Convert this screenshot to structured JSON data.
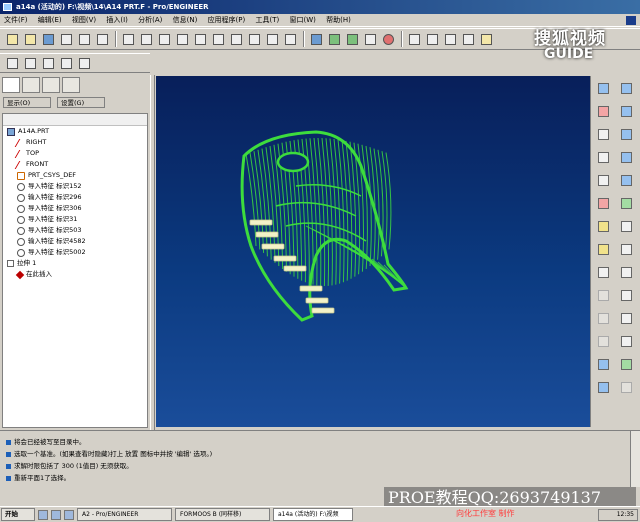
{
  "window": {
    "title": "a14a (活动的) F:\\视频\\14\\A14 PRT.F - Pro/ENGINEER"
  },
  "menubar": {
    "items": [
      "文件(F)",
      "编辑(E)",
      "视图(V)",
      "插入(I)",
      "分析(A)",
      "信息(N)",
      "应用程序(P)",
      "工具(T)",
      "窗口(W)",
      "帮助(H)"
    ]
  },
  "logo": {
    "main": "搜狐视频",
    "sub": "GUIDE"
  },
  "left_panel": {
    "dropdowns": [
      "显示(O)",
      "设置(G)"
    ],
    "tree": [
      {
        "label": "A14A.PRT",
        "icon": "part-icon",
        "indent": 0
      },
      {
        "label": "RIGHT",
        "icon": "datum-plane-icon",
        "indent": 1
      },
      {
        "label": "TOP",
        "icon": "datum-plane-icon",
        "indent": 1
      },
      {
        "label": "FRONT",
        "icon": "datum-plane-icon",
        "indent": 1
      },
      {
        "label": "PRT_CSYS_DEF",
        "icon": "csys-icon",
        "indent": 1
      },
      {
        "label": "导入特征 标识152",
        "icon": "feature-icon",
        "indent": 1
      },
      {
        "label": "输入特征 标识296",
        "icon": "feature-icon",
        "indent": 1
      },
      {
        "label": "导入特征 标识306",
        "icon": "feature-icon",
        "indent": 1
      },
      {
        "label": "导入特征 标识31",
        "icon": "feature-icon",
        "indent": 1
      },
      {
        "label": "导入特征 标识503",
        "icon": "feature-icon",
        "indent": 1
      },
      {
        "label": "输入特征 标识4582",
        "icon": "feature-icon",
        "indent": 1
      },
      {
        "label": "导入特征 标识5002",
        "icon": "feature-icon",
        "indent": 1
      },
      {
        "label": "拉伸 1",
        "icon": "expand-icon",
        "indent": 0
      },
      {
        "label": "在此插入",
        "icon": "insert-here-icon",
        "indent": 1
      }
    ]
  },
  "messages": [
    "将会已经被写至目录中。",
    "选取一个基准。(如果查看时隐藏)打上 放置 图标中并按 '编辑' 选项。)",
    "求解时限包括了 300 (1值目) 无须获取。",
    "重新平面1了选择。"
  ],
  "watermark": {
    "text": "PROE教程QQ:2693749137",
    "credit": "向化工作室 制作"
  },
  "taskbar": {
    "start": "开始",
    "tasks": [
      "A2 - Pro/ENGINEER",
      "FORMOOS B (同样移)",
      "a14a (活动的) F:\\视频"
    ],
    "clock": "12:35"
  }
}
